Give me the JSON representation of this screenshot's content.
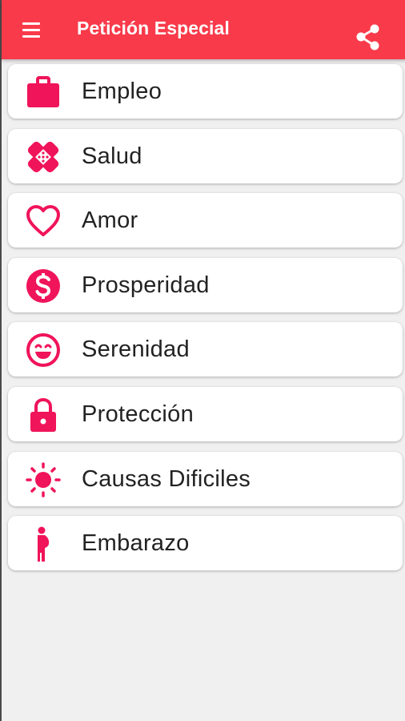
{
  "app": {
    "title": "Petición Especial",
    "accent_color": "#f93a4a",
    "icon_color": "#f0145a"
  },
  "toolbar": {
    "menu_icon": "hamburger-menu-icon",
    "share_icon": "share-icon"
  },
  "categories": [
    {
      "label": "Empleo",
      "icon": "briefcase-icon"
    },
    {
      "label": "Salud",
      "icon": "bandage-icon"
    },
    {
      "label": "Amor",
      "icon": "heart-icon"
    },
    {
      "label": "Prosperidad",
      "icon": "dollar-icon"
    },
    {
      "label": "Serenidad",
      "icon": "smile-icon"
    },
    {
      "label": "Protección",
      "icon": "lock-icon"
    },
    {
      "label": "Causas Dificiles",
      "icon": "sun-icon"
    },
    {
      "label": "Embarazo",
      "icon": "pregnant-icon"
    }
  ]
}
